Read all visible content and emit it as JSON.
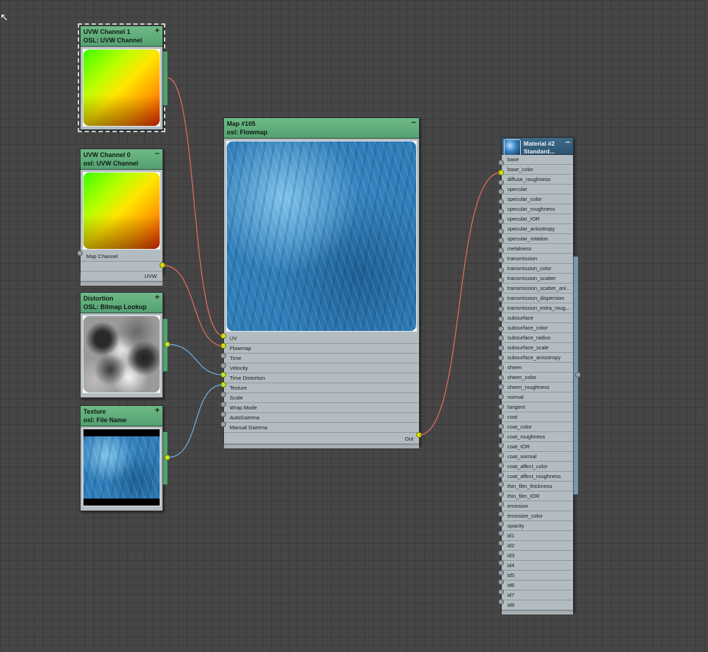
{
  "nodes": {
    "uvw1": {
      "title": "UVW Channel 1",
      "subtitle": "OSL: UVW Channel",
      "btn": "+"
    },
    "uvw0": {
      "title": "UVW Channel 0",
      "subtitle": "osl: UVW Channel",
      "btn": "−",
      "inputs": [
        "Map Channel"
      ],
      "outputs": [
        "UVW"
      ]
    },
    "distortion": {
      "title": "Distortion",
      "subtitle": "OSL: Bitmap Lookup",
      "btn": "+"
    },
    "texture": {
      "title": "Texture",
      "subtitle": "osl: File Name",
      "btn": "+"
    },
    "flowmap": {
      "title": "Map #105",
      "subtitle": "osl: Flowmap",
      "btn": "−",
      "inputs": [
        "UV",
        "Flowmap",
        "Time",
        "Velocity",
        "Time Distortion",
        "Texture",
        "Scale",
        "Wrap Mode",
        "AutoGamma",
        "Manual Gamma"
      ],
      "output": "Out"
    },
    "material": {
      "title": "Material #2",
      "subtitle": "Standard...",
      "btn": "−",
      "inputs": [
        "base",
        "base_color",
        "diffuse_roughness",
        "specular",
        "specular_color",
        "specular_roughness",
        "specular_IOR",
        "specular_anisotropy",
        "specular_rotation",
        "metalness",
        "transmission",
        "transmission_color",
        "transmission_scatter",
        "transmission_scatter_ani...",
        "transmission_dispersion",
        "transmission_extra_roug...",
        "subsurface",
        "subsurface_color",
        "subsurface_radius",
        "subsurface_scale",
        "subsurface_anisotropy",
        "sheen",
        "sheen_color",
        "sheen_roughness",
        "normal",
        "tangent",
        "coat",
        "coat_color",
        "coat_roughness",
        "coat_IOR",
        "coat_normal",
        "coat_affect_color",
        "coat_affect_roughness",
        "thin_film_thickness",
        "thin_film_IOR",
        "emission",
        "emission_color",
        "opacity",
        "id1",
        "id2",
        "id3",
        "id4",
        "id5",
        "id6",
        "id7",
        "id8"
      ]
    }
  },
  "colors": {
    "canvas": "#464646",
    "node_header": "#5aa876",
    "material_header": "#35617f",
    "active_socket": "#d8f000",
    "wire_red": "#e8705c",
    "wire_blue": "#6fb2e6"
  }
}
